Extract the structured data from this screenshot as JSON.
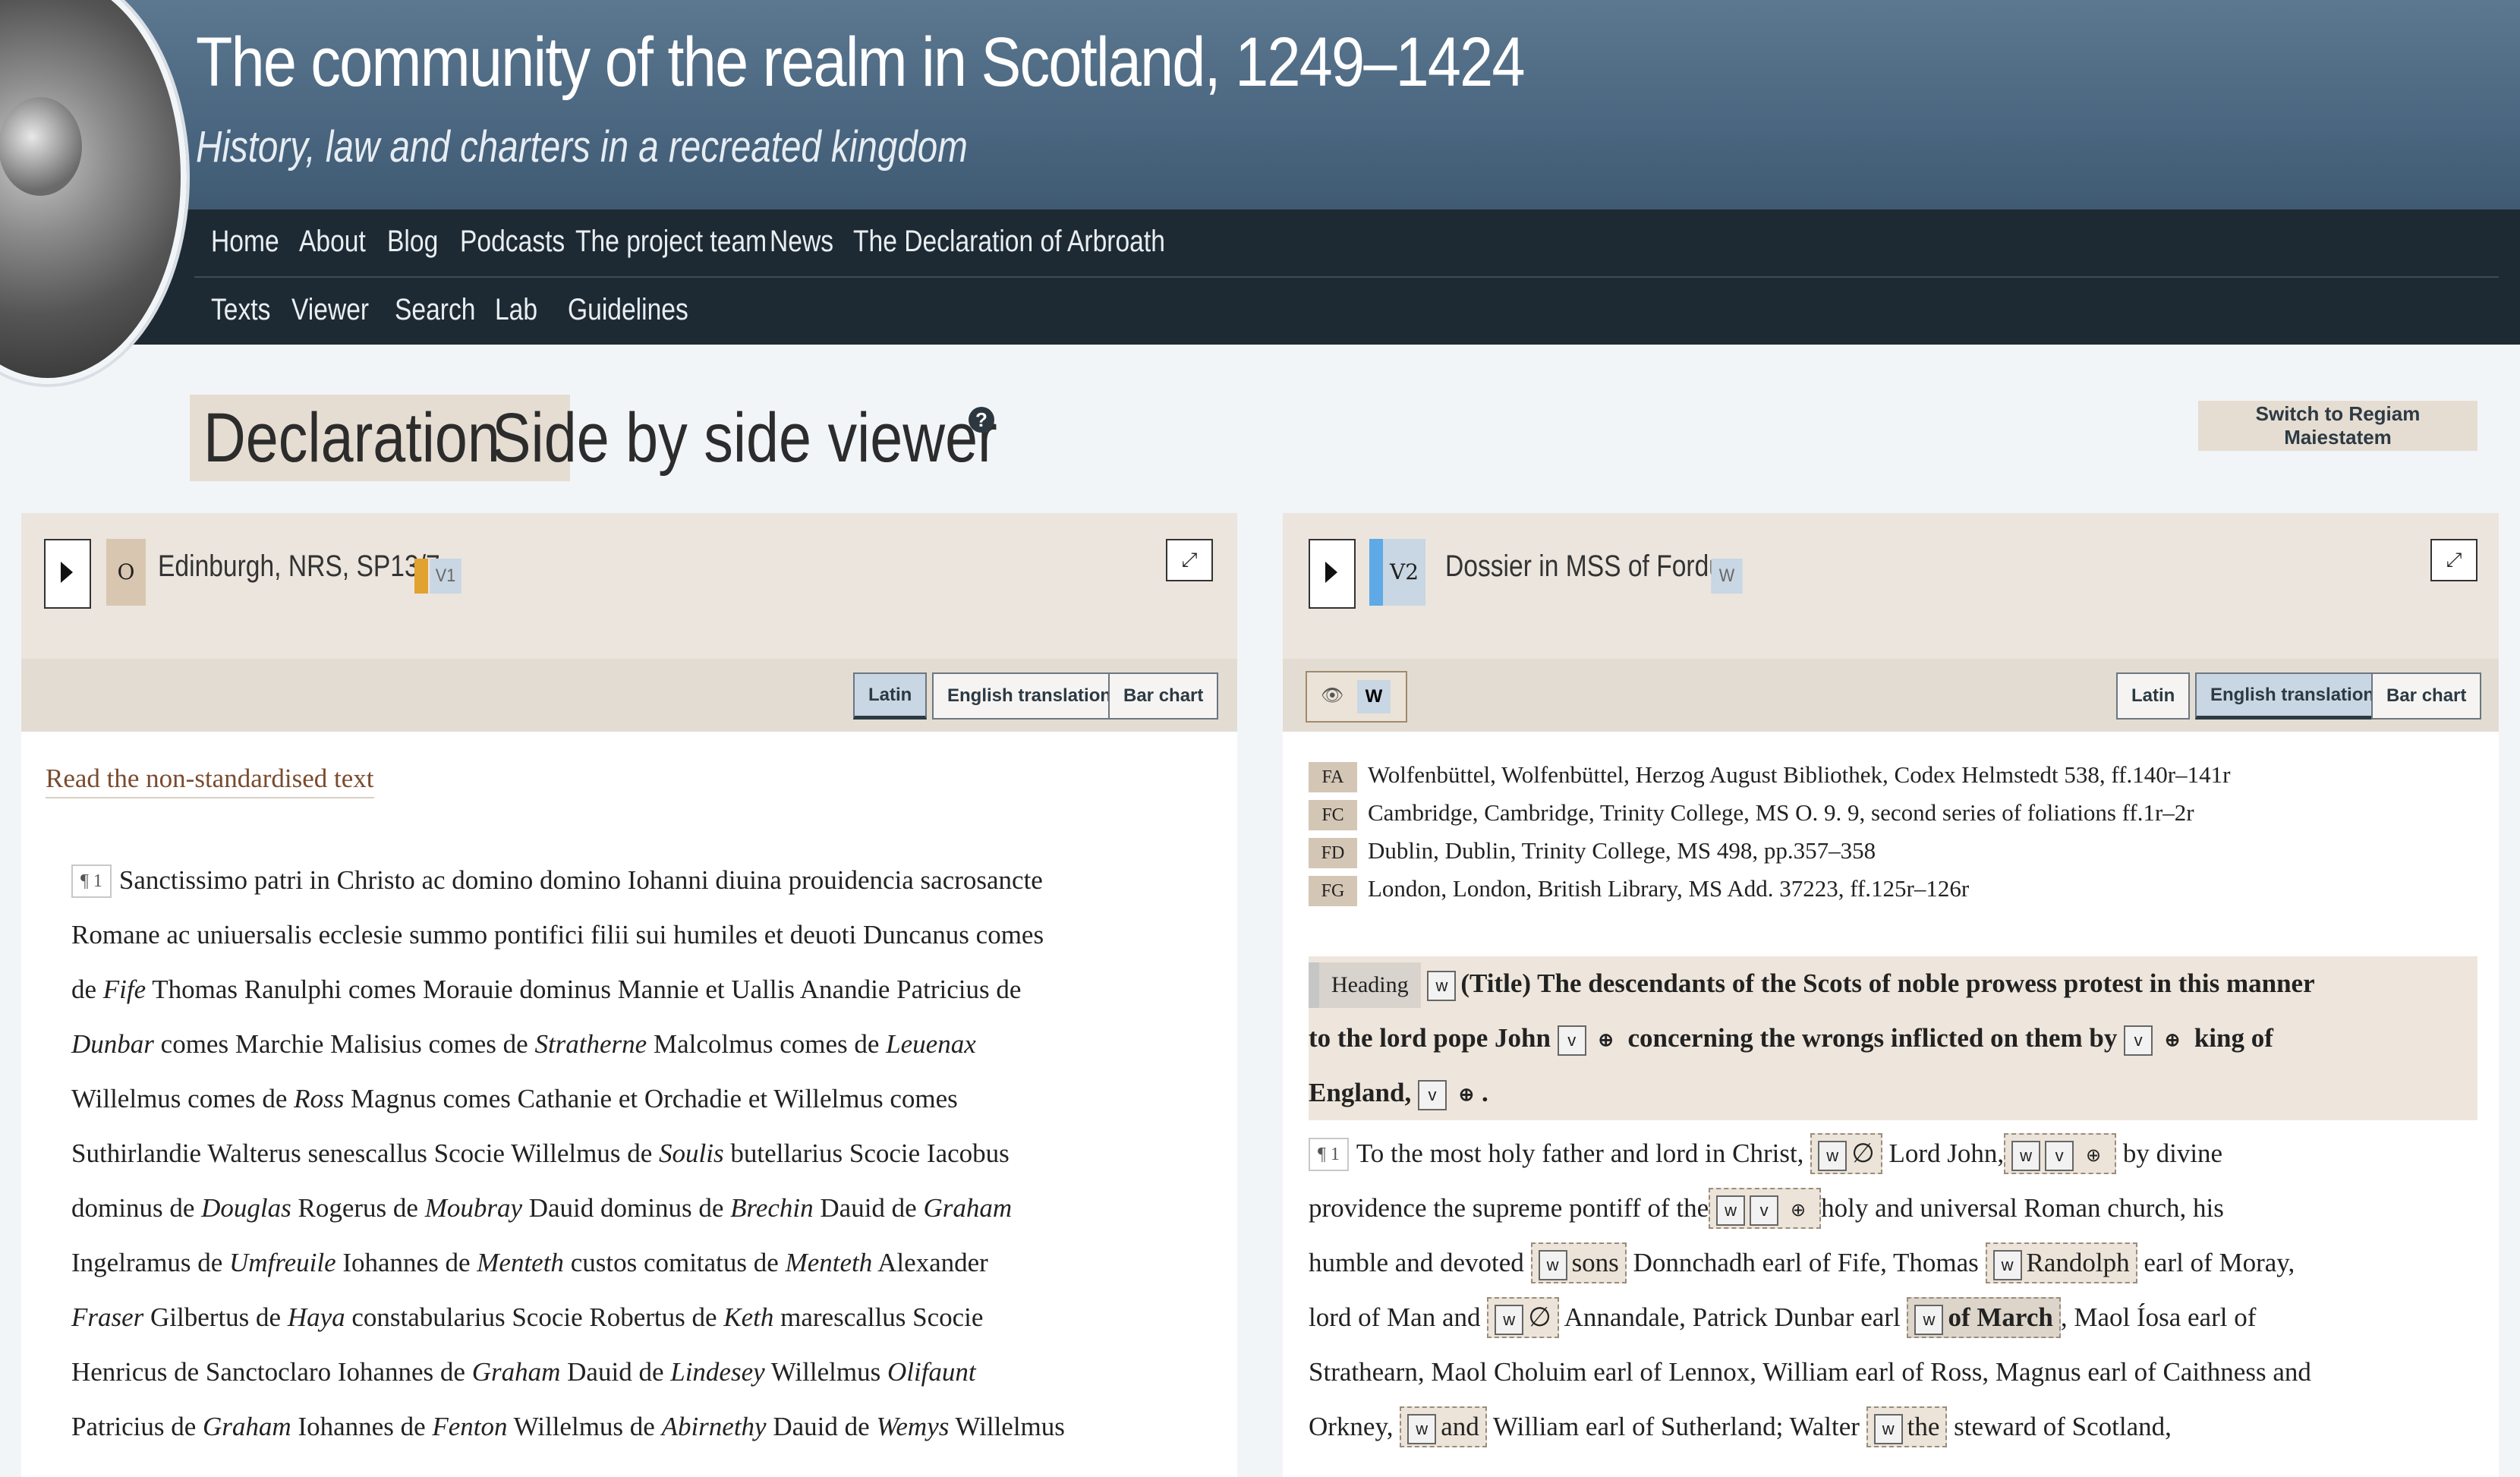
{
  "site": {
    "title": "The community of the realm in Scotland, 1249–1424",
    "subtitle": "History, law and charters in a recreated kingdom"
  },
  "nav": {
    "primary": [
      "Home",
      "About",
      "Blog",
      "Podcasts",
      "The project team",
      "News",
      "The Declaration of Arbroath"
    ],
    "secondary": [
      "Texts",
      "Viewer",
      "Search",
      "Lab",
      "Guidelines"
    ]
  },
  "page": {
    "title_highlight": "Declaration",
    "title_rest": "Side by side viewer",
    "help_icon": "?",
    "switch_button": "Switch to Regiam Maiestatem"
  },
  "left_panel": {
    "witness_siglum": "O",
    "witness_name": "Edinburgh, NRS, SP13/7",
    "version_tag": "V1",
    "tabs": [
      "Latin",
      "English translation",
      "Bar chart"
    ],
    "active_tab": "Latin",
    "read_link": "Read the non-standardised text",
    "para_marker": "¶ 1",
    "text_lines": [
      "Sanctissimo patri in Christo ac domino domino Iohanni diuina prouidencia sacrosancte",
      "Romane ac uniuersalis ecclesie summo pontifici filii sui humiles et deuoti Duncanus comes",
      "de",
      "Fife",
      "Thomas Ranulphi comes Morauie dominus Mannie et Uallis Anandie Patricius de",
      "Dunbar",
      "comes Marchie Malisius comes de",
      "Stratherne",
      "Malcolmus comes de",
      "Leuenax",
      "Willelmus comes de",
      "Ross",
      "Magnus comes Cathanie et Orchadie et Willelmus comes",
      "Suthirlandie Walterus senescallus Scocie Willelmus de",
      "Soulis",
      "butellarius Scocie Iacobus",
      "dominus de",
      "Douglas",
      "Rogerus de",
      "Moubray",
      "Dauid dominus de",
      "Brechin",
      "Dauid de",
      "Graham",
      "Ingelramus de",
      "Umfreuile",
      "Iohannes de",
      "Menteth",
      "custos comitatus de",
      "Menteth",
      "Alexander",
      "Fraser",
      "Gilbertus de",
      "Haya",
      "constabularius Scocie Robertus de",
      "Keth",
      "marescallus Scocie",
      "Henricus de Sanctoclaro Iohannes de",
      "Graham",
      "Dauid de",
      "Lindesey",
      "Willelmus",
      "Olifaunt",
      "Patricius de",
      "Graham",
      "Iohannes de",
      "Fenton",
      "Willelmus de",
      "Abirnethy",
      "Dauid de",
      "Wemys",
      "Willelmus"
    ]
  },
  "right_panel": {
    "witness_siglum": "V2",
    "witness_name": "Dossier in MSS of Fordun",
    "version_tag": "W",
    "eye_tag": "W",
    "tabs": [
      "Latin",
      "English translation",
      "Bar chart"
    ],
    "active_tab": "English translation",
    "manuscripts": [
      {
        "code": "FA",
        "desc": "Wolfenbüttel, Wolfenbüttel, Herzog August Bibliothek, Codex Helmstedt 538, ff.140r–141r"
      },
      {
        "code": "FC",
        "desc": "Cambridge, Cambridge, Trinity College, MS O. 9. 9, second series of foliations ff.1r–2r"
      },
      {
        "code": "FD",
        "desc": "Dublin, Dublin, Trinity College, MS 498, pp.357–358"
      },
      {
        "code": "FG",
        "desc": "London, London, British Library, MS Add. 37223, ff.125r–126r"
      }
    ],
    "heading_label": "Heading",
    "heading_parts": [
      "(Title) The descendants of the Scots of noble prowess protest in this manner",
      "to the lord pope John",
      "concerning the wrongs inflicted on them by",
      "king of",
      "England,",
      "."
    ],
    "para_marker": "¶ 1",
    "text_parts": [
      "To the most holy father and lord in Christ,",
      "Lord John,",
      "by divine",
      "providence the supreme pontiff of the",
      "holy and universal Roman church, his",
      "humble and devoted",
      "sons",
      "Donnchadh earl of Fife, Thomas",
      "Randolph",
      "earl of Moray,",
      "lord of Man and",
      "Annandale, Patrick Dunbar earl",
      "of March",
      ", Maol Íosa earl of",
      "Strathearn, Maol Choluim earl of Lennox, William earl of Ross, Magnus earl of Caithness and",
      "Orkney,",
      "and",
      "William earl of Sutherland; Walter",
      "the",
      "steward of Scotland,"
    ],
    "keys": {
      "w": "w",
      "v": "v",
      "plus": "⊕",
      "empty": "∅"
    }
  }
}
